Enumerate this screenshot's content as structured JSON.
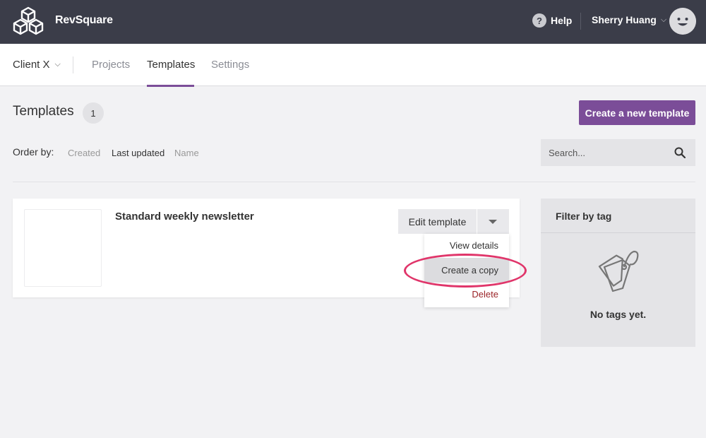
{
  "app": {
    "brand": "RevSquare"
  },
  "topbar": {
    "help_label": "Help",
    "help_icon": "?",
    "user_name": "Sherry Huang",
    "chevron": "⌵"
  },
  "subnav": {
    "client_label": "Client X",
    "chevron": "⌵",
    "tabs": [
      {
        "label": "Projects"
      },
      {
        "label": "Templates",
        "active": true
      },
      {
        "label": "Settings"
      }
    ]
  },
  "page": {
    "title": "Templates",
    "count": "1",
    "new_template_label": "Create a new template"
  },
  "order": {
    "label": "Order by:",
    "options": [
      {
        "label": "Created"
      },
      {
        "label": "Last updated",
        "active": true
      },
      {
        "label": "Name"
      }
    ]
  },
  "search": {
    "placeholder": "Search..."
  },
  "templates": [
    {
      "title": "Standard weekly newsletter",
      "edit_label": "Edit template",
      "menu": {
        "view_details": "View details",
        "create_copy": "Create a copy",
        "delete": "Delete"
      }
    }
  ],
  "filter": {
    "title": "Filter by tag",
    "empty_text": "No tags yet."
  },
  "colors": {
    "topbar": "#3b3d49",
    "accent": "#7b4d98",
    "highlight_ring": "#e0356a",
    "delete": "#9b2428"
  }
}
